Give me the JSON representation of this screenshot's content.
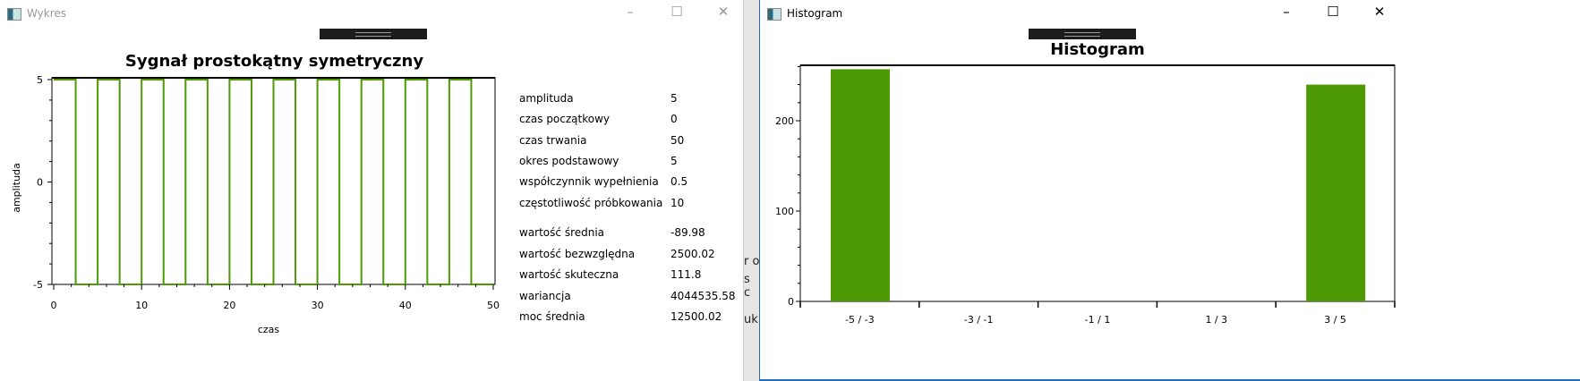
{
  "wykres": {
    "title": "Wykres",
    "chart_title": "Sygnał prostokątny symetryczny",
    "params": [
      {
        "label": "amplituda",
        "value": "5"
      },
      {
        "label": "czas początkowy",
        "value": "0"
      },
      {
        "label": "czas trwania",
        "value": "50"
      },
      {
        "label": "okres podstawowy",
        "value": "5"
      },
      {
        "label": "współczynnik wypełnienia",
        "value": "0.5"
      },
      {
        "label": "częstotliwość próbkowania",
        "value": "10"
      }
    ],
    "stats": [
      {
        "label": "wartość średnia",
        "value": "-89.98"
      },
      {
        "label": "wartość bezwzględna",
        "value": "2500.02"
      },
      {
        "label": "wartość skuteczna",
        "value": "111.8"
      },
      {
        "label": "wariancja",
        "value": "4044535.58"
      },
      {
        "label": "moc średnia",
        "value": "12500.02"
      }
    ]
  },
  "background": {
    "fragments": [
      "r o",
      "s c",
      "uk"
    ]
  },
  "histogram_window": {
    "title": "Histogram"
  },
  "window_controls": {
    "minimize": "–",
    "maximize": "☐",
    "close": "✕"
  },
  "chart_data": [
    {
      "type": "line",
      "title": "Sygnał prostokątny symetryczny",
      "xlabel": "czas",
      "ylabel": "amplituda",
      "xlim": [
        0,
        50
      ],
      "ylim": [
        -5,
        5
      ],
      "xticks": [
        0,
        10,
        20,
        30,
        40,
        50
      ],
      "yticks": [
        -5,
        0,
        5
      ],
      "amplitude": 5,
      "period": 5,
      "duty": 0.5,
      "color": "#4e9a06"
    },
    {
      "type": "bar",
      "title": "Histogram",
      "categories": [
        "-5 / -3",
        "-3 / -1",
        "-1 / 1",
        "1 / 3",
        "3 / 5"
      ],
      "values": [
        257,
        0,
        0,
        0,
        240
      ],
      "ylim": [
        0,
        260
      ],
      "yticks": [
        0,
        100,
        200
      ],
      "color": "#4e9a06"
    }
  ]
}
